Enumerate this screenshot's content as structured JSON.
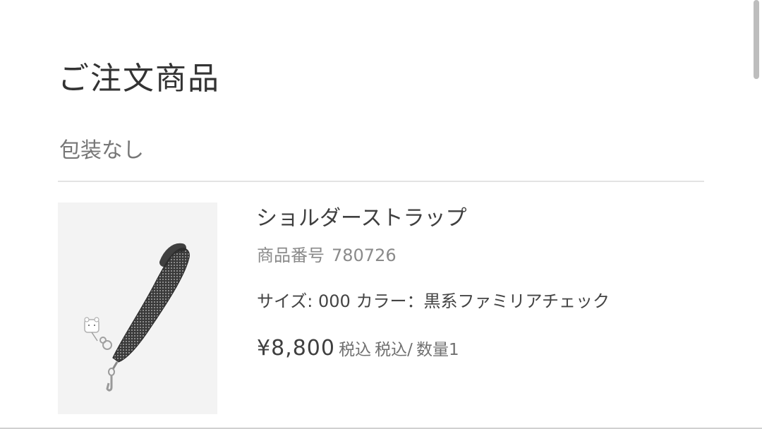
{
  "section": {
    "title": "ご注文商品",
    "wrapping": "包装なし"
  },
  "item": {
    "image_icon": "shoulder-strap-image",
    "name": "ショルダーストラップ",
    "number_label": "商品番号",
    "number": "780726",
    "size_label": "サイズ:",
    "size_value": "000",
    "color_label": "カラー：",
    "color_value": "黒系ファミリアチェック",
    "price": "¥8,800",
    "tax1": "税込",
    "tax2": "税込/",
    "quantity": "数量1"
  },
  "colors": {
    "scrollbar": "#bdbdbd",
    "divider": "#e3e3e3",
    "thumb_bg": "#f3f3f3"
  }
}
